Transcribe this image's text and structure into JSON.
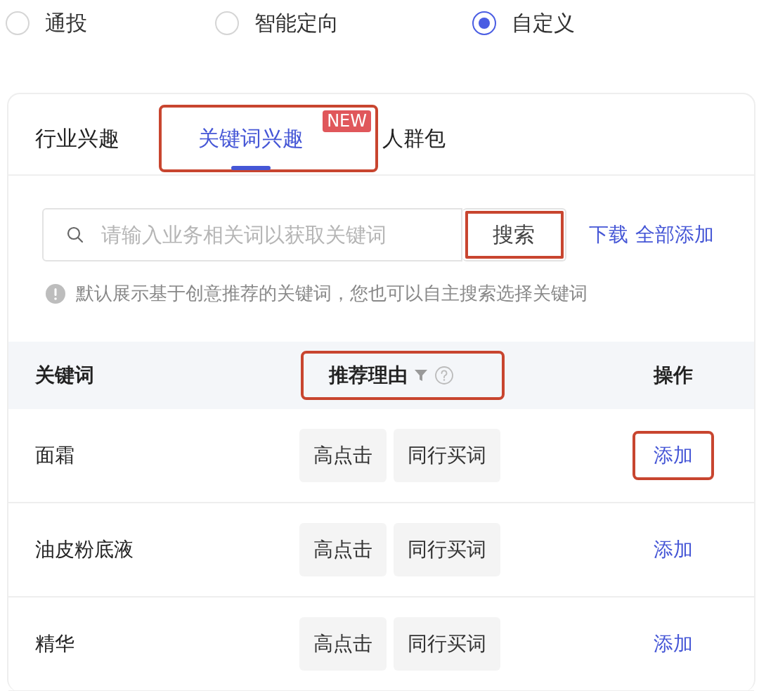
{
  "targeting": [
    {
      "label": "通投",
      "selected": false
    },
    {
      "label": "智能定向",
      "selected": false
    },
    {
      "label": "自定义",
      "selected": true
    }
  ],
  "tabs": [
    {
      "label": "行业兴趣",
      "selected": false,
      "highlighted": false
    },
    {
      "label": "关键词兴趣",
      "selected": true,
      "highlighted": true,
      "badge": "NEW"
    },
    {
      "label": "人群包",
      "selected": false,
      "highlighted": false
    }
  ],
  "search": {
    "placeholder": "请输入业务相关词以获取关键词",
    "button": "搜索",
    "button_highlighted": true
  },
  "links": [
    "下载",
    "全部添加"
  ],
  "hint": "默认展示基于创意推荐的关键词，您也可以自主搜索选择关键词",
  "table": {
    "columns": [
      {
        "label": "关键词"
      },
      {
        "label": "推荐理由",
        "highlighted": true,
        "filter": true,
        "help": true
      },
      {
        "label": "操作"
      }
    ],
    "rows": [
      {
        "keyword": "面霜",
        "reasons": [
          "高点击",
          "同行买词"
        ],
        "action": "添加",
        "action_highlighted": true
      },
      {
        "keyword": "油皮粉底液",
        "reasons": [
          "高点击",
          "同行买词"
        ],
        "action": "添加",
        "action_highlighted": false
      },
      {
        "keyword": "精华",
        "reasons": [
          "高点击",
          "同行买词"
        ],
        "action": "添加",
        "action_highlighted": false
      }
    ]
  }
}
